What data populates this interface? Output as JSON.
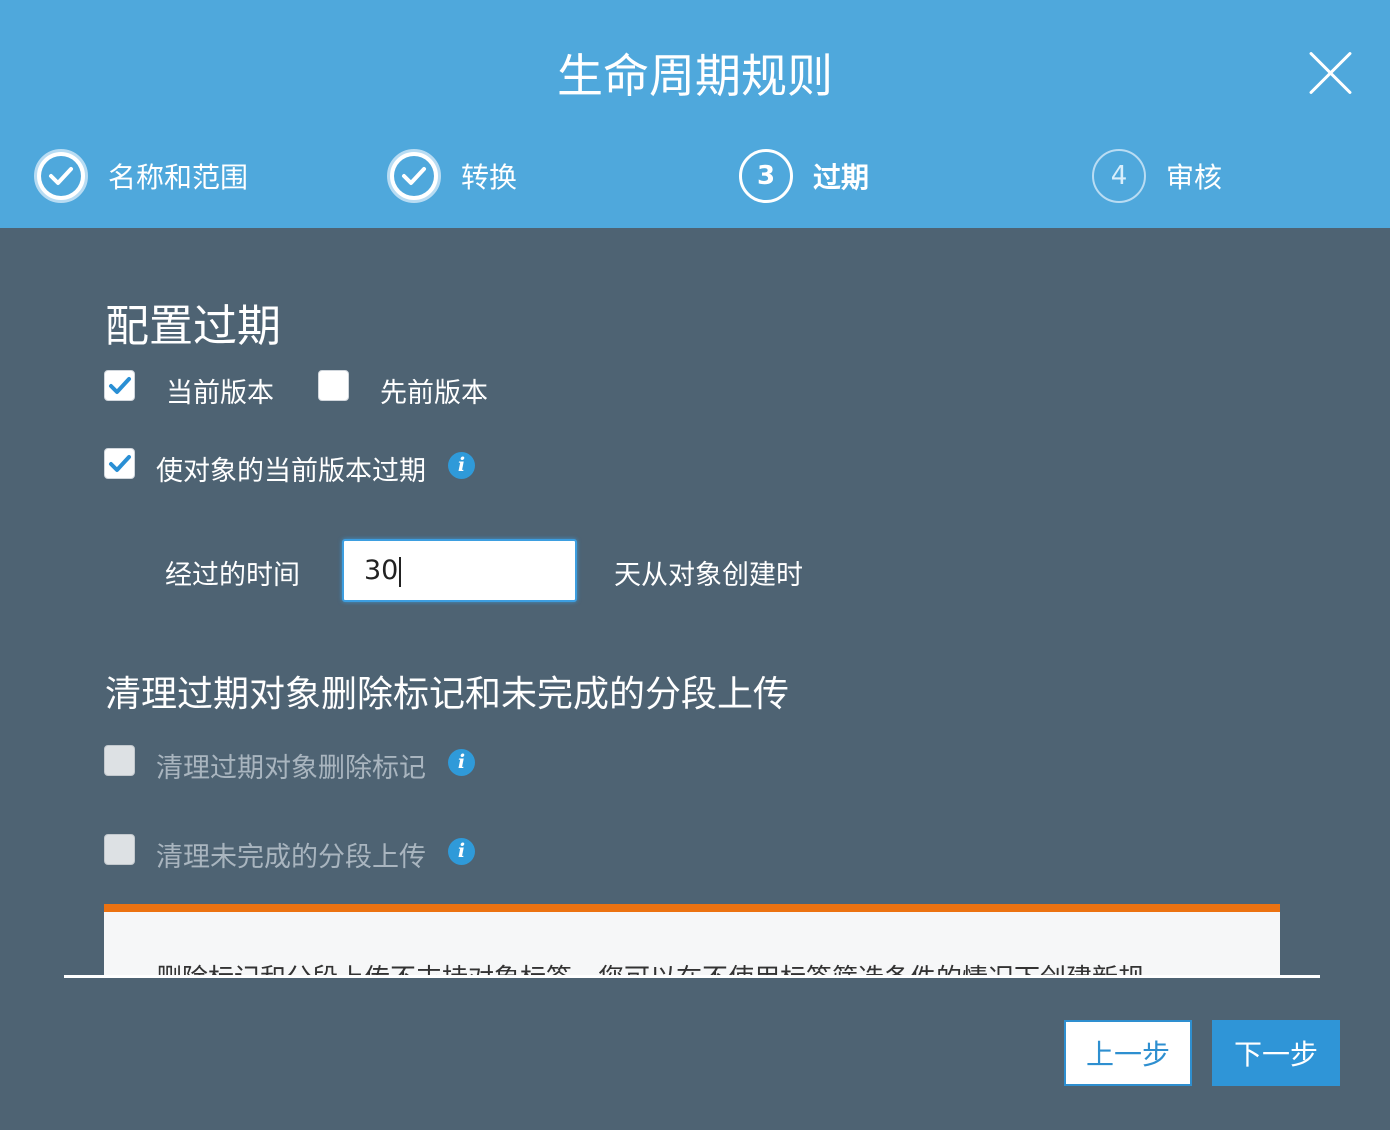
{
  "dialog": {
    "title": "生命周期规则"
  },
  "steps": [
    {
      "number": "1",
      "label": "名称和范围",
      "state": "done"
    },
    {
      "number": "2",
      "label": "转换",
      "state": "done"
    },
    {
      "number": "3",
      "label": "过期",
      "state": "current"
    },
    {
      "number": "4",
      "label": "审核",
      "state": "pending"
    }
  ],
  "configure": {
    "title": "配置过期",
    "current_version": {
      "label": "当前版本",
      "checked": true
    },
    "previous_version": {
      "label": "先前版本",
      "checked": false
    },
    "expire_current": {
      "label": "使对象的当前版本过期",
      "checked": true
    },
    "elapsed_label": "经过的时间",
    "days_value": "30",
    "days_suffix": "天从对象创建时"
  },
  "cleanup": {
    "title": "清理过期对象删除标记和未完成的分段上传",
    "delete_markers": {
      "label": "清理过期对象删除标记",
      "checked": false,
      "disabled": true
    },
    "multipart": {
      "label": "清理未完成的分段上传",
      "checked": false,
      "disabled": true
    }
  },
  "warning": {
    "text": "删除标记和分段上传不支持对象标签。您可以在不使用标签筛选条件的情况下创建新规"
  },
  "buttons": {
    "previous": "上一步",
    "next": "下一步"
  },
  "colors": {
    "header": "#4fa8dc",
    "body": "#4e6373",
    "accent": "#2f95d7",
    "warning": "#ec7211"
  }
}
